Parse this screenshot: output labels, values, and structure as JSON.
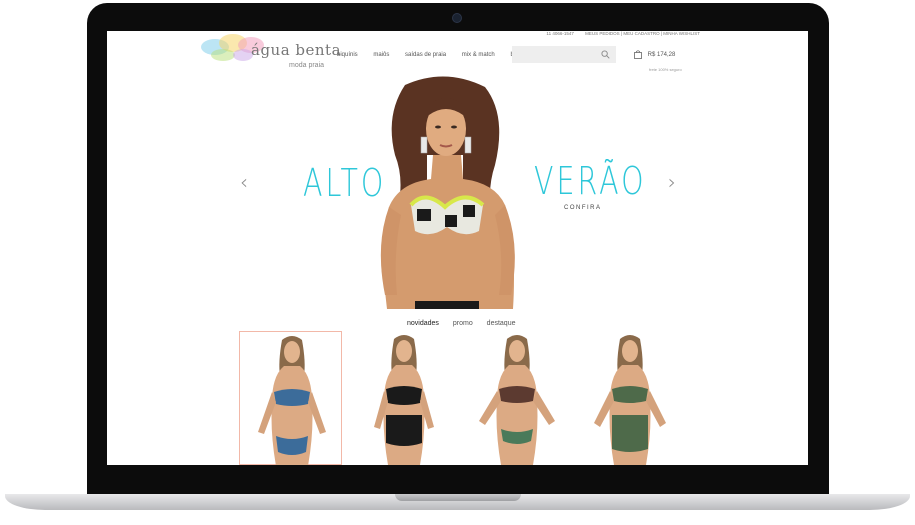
{
  "header": {
    "phone": "11 4066-1547",
    "account_links": "MEUS PEDIDOS | MEU CADASTRO | MINHA WISHLIST",
    "logo_title": "água benta",
    "logo_sub": "moda praia",
    "nav": [
      "biquínis",
      "maiôs",
      "saídas de praia",
      "mix & match",
      "bodies"
    ],
    "search_placeholder": "",
    "cart_total": "R$ 174,28",
    "free_shipping": "frete 100% seguro"
  },
  "hero": {
    "left_word": "ALTO",
    "right_word": "VERÃO",
    "cta": "CONFIRA",
    "prev": "‹",
    "next": "›"
  },
  "tabs": [
    "novidades",
    "promo",
    "destaque"
  ],
  "colors": {
    "accent": "#2ec7d9",
    "selected_border": "#f2b8a8"
  },
  "products": [
    {
      "name": "blue-print-bikini",
      "selected": true
    },
    {
      "name": "black-highwaist-bikini",
      "selected": false
    },
    {
      "name": "tribal-print-bikini",
      "selected": false
    },
    {
      "name": "green-print-highwaist-bikini",
      "selected": false
    }
  ]
}
